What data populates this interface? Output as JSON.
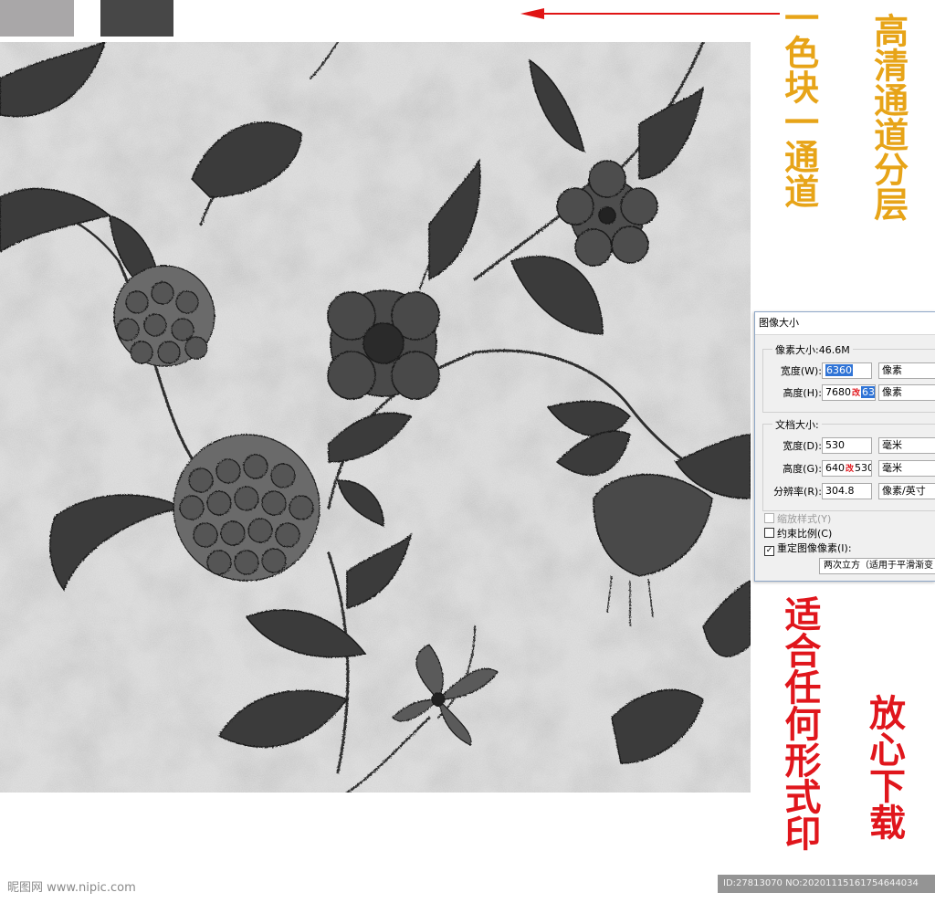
{
  "swatches": {
    "light_color": "#a9a7a8",
    "dark_color": "#474747"
  },
  "arrow": {
    "color": "#e01414",
    "direction": "left"
  },
  "pattern": {
    "background_color": "#cfcfcf",
    "ink_color": "#2e2e2e",
    "motif": "vintage floral hydrangea and vines, grayscale"
  },
  "captions": {
    "one_block_one_channel": "一色块一通道",
    "hd_channel_layering": "高清通道分层",
    "fit_any_print": "适合任何形式印",
    "download_assured": "放心下载"
  },
  "dialog": {
    "title": "图像大小",
    "pixel_size_label": "像素大小:46.6M",
    "width_label": "宽度(W):",
    "width_value": "6360",
    "width_unit": "像素",
    "height_label": "高度(H):",
    "height_value_old": "7680",
    "height_value_change_mark": "改",
    "height_value": "6360",
    "height_unit": "像素",
    "doc_size_label": "文档大小:",
    "doc_width_label": "宽度(D):",
    "doc_width_value": "530",
    "doc_width_unit": "毫米",
    "doc_height_label": "高度(G):",
    "doc_height_value_old": "640",
    "doc_height_change_mark": "改",
    "doc_height_value": "530",
    "doc_height_unit": "毫米",
    "resolution_label": "分辨率(R):",
    "resolution_value": "304.8",
    "resolution_unit": "像素/英寸",
    "scale_styles_label": "缩放样式(Y)",
    "constrain_label": "约束比例(C)",
    "resample_label": "重定图像像素(I):",
    "resample_value": "两次立方（适用于平滑渐变"
  },
  "watermarks": {
    "left": "昵图网 www.nipic.com",
    "right": "ID:27813070 NO:20201115161754644034"
  }
}
